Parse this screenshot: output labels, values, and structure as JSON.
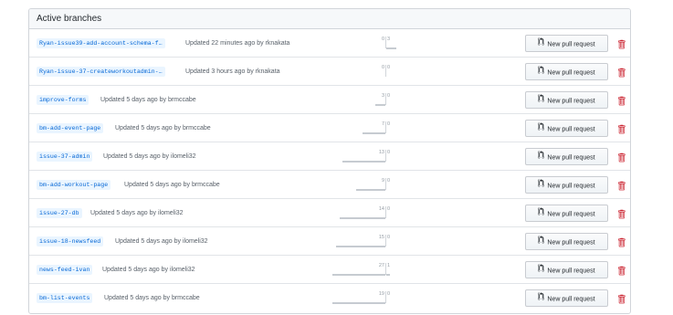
{
  "header": {
    "title": "Active branches"
  },
  "button_label": "New pull request",
  "rows": [
    {
      "branch": "Ryan-issue39-add-account-schema-f…",
      "updated": "Updated 22 minutes ago by",
      "author": "rknakata",
      "behind": "0",
      "ahead": "3"
    },
    {
      "branch": "Ryan-issue-37-createworkoutadmin-…",
      "updated": "Updated 3 hours ago by",
      "author": "rknakata",
      "behind": "0",
      "ahead": "0"
    },
    {
      "branch": "improve-forms",
      "updated": "Updated 5 days ago by",
      "author": "brmccabe",
      "behind": "3",
      "ahead": "0"
    },
    {
      "branch": "bm-add-event-page",
      "updated": "Updated 5 days ago by",
      "author": "brmccabe",
      "behind": "7",
      "ahead": "0"
    },
    {
      "branch": "issue-37-admin",
      "updated": "Updated 5 days ago by",
      "author": "ilomeli32",
      "behind": "13",
      "ahead": "0"
    },
    {
      "branch": "bm-add-workout-page",
      "updated": "Updated 5 days ago by",
      "author": "brmccabe",
      "behind": "9",
      "ahead": "0"
    },
    {
      "branch": "issue-27-db",
      "updated": "Updated 5 days ago by",
      "author": "ilomeli32",
      "behind": "14",
      "ahead": "0"
    },
    {
      "branch": "issue-18-newsfeed",
      "updated": "Updated 5 days ago by",
      "author": "ilomeli32",
      "behind": "15",
      "ahead": "0"
    },
    {
      "branch": "news-feed-ivan",
      "updated": "Updated 5 days ago by",
      "author": "ilomeli32",
      "behind": "27",
      "ahead": "1"
    },
    {
      "branch": "bm-list-events",
      "updated": "Updated 5 days ago by",
      "author": "brmccabe",
      "behind": "19",
      "ahead": "0"
    }
  ],
  "colors": {
    "link": "#0366d6",
    "trash": "#cb2431",
    "border": "#d1d5da"
  },
  "icons": {
    "pr": "git-pull-request-icon",
    "delete": "trash-icon"
  }
}
